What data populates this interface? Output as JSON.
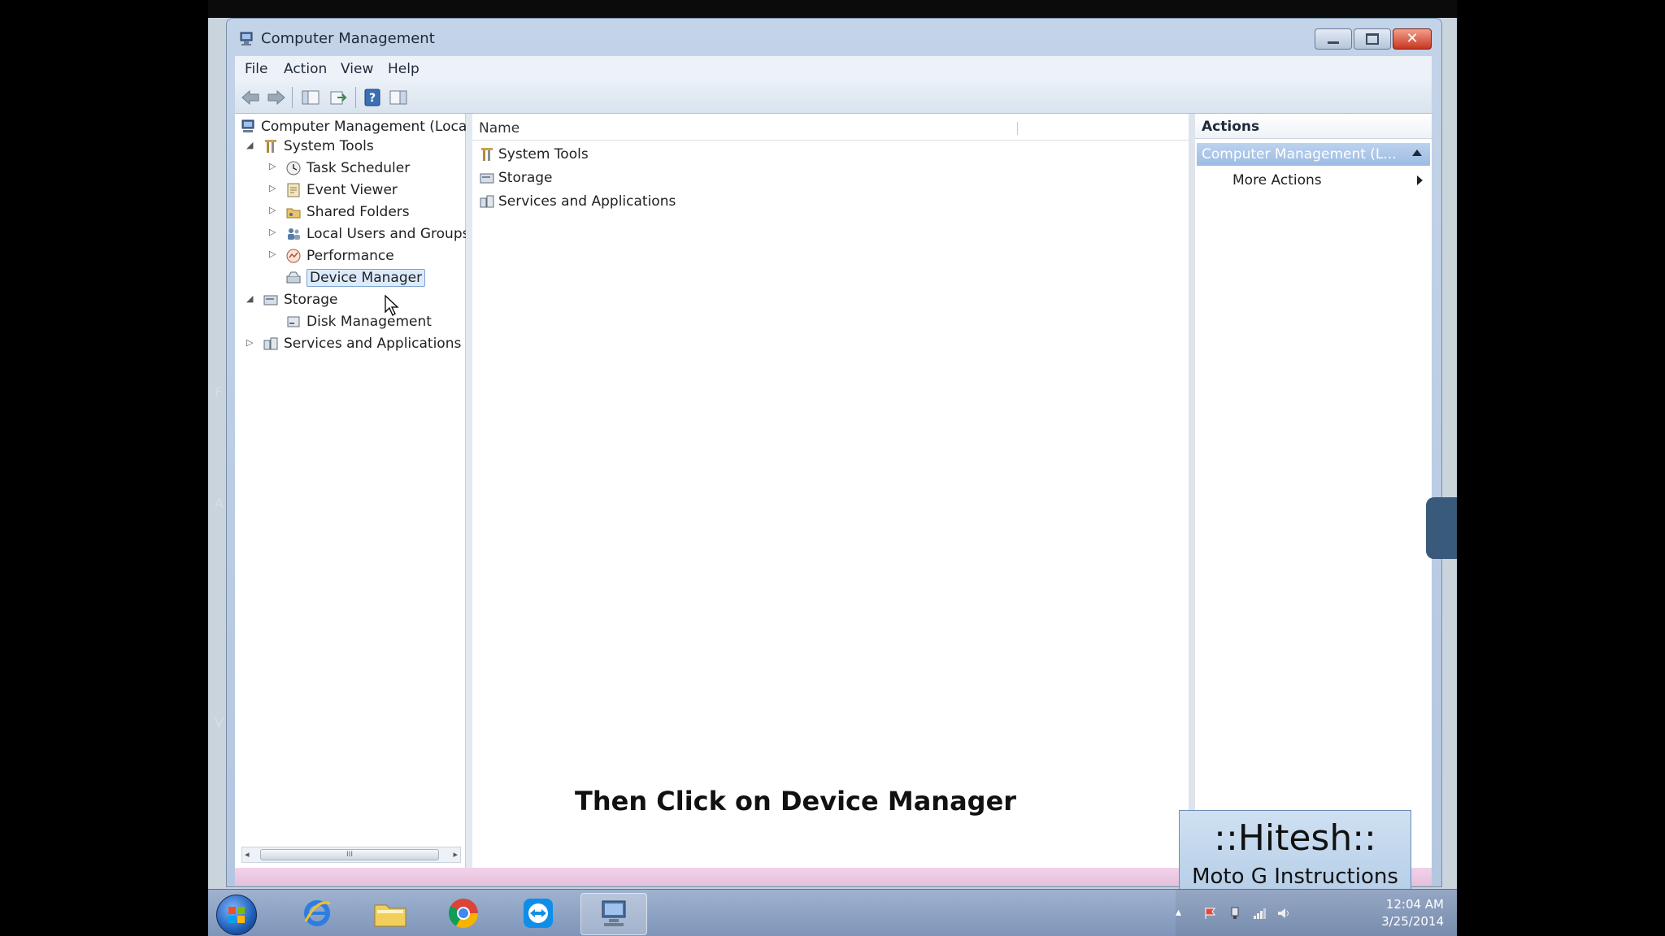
{
  "desktop": {
    "left_fragments": [
      "F",
      "A",
      "V"
    ]
  },
  "window": {
    "title": "Computer Management",
    "controls": {
      "minimize": "",
      "maximize": "",
      "close": "✕"
    }
  },
  "menu": [
    "File",
    "Action",
    "View",
    "Help"
  ],
  "toolbar": [
    "back-icon",
    "forward-icon",
    "show-hide-tree-icon",
    "export-list-icon",
    "help-icon",
    "show-hide-action-pane-icon"
  ],
  "tree": {
    "root": "Computer Management (Local",
    "items": [
      {
        "label": "System Tools",
        "level": 1,
        "expanded": true
      },
      {
        "label": "Task Scheduler",
        "level": 2
      },
      {
        "label": "Event Viewer",
        "level": 2
      },
      {
        "label": "Shared Folders",
        "level": 2
      },
      {
        "label": "Local Users and Groups",
        "level": 2
      },
      {
        "label": "Performance",
        "level": 2
      },
      {
        "label": "Device Manager",
        "level": 2,
        "selected": true
      },
      {
        "label": "Storage",
        "level": 1,
        "expanded": true
      },
      {
        "label": "Disk Management",
        "level": 2
      },
      {
        "label": "Services and Applications",
        "level": 1
      }
    ],
    "scrollbar_thumb": "III"
  },
  "list": {
    "column_name": "Name",
    "rows": [
      "System Tools",
      "Storage",
      "Services and Applications"
    ]
  },
  "actions": {
    "title": "Actions",
    "section": "Computer Management (L...",
    "more": "More Actions"
  },
  "caption": "Then Click on Device Manager",
  "overlay": {
    "line1": "::Hitesh::",
    "line2": "Moto G Instructions"
  },
  "taskbar": {
    "apps": [
      "internet-explorer-icon",
      "file-explorer-icon",
      "chrome-icon",
      "teamviewer-icon",
      "computer-management-icon"
    ],
    "clock": {
      "time": "12:04 AM",
      "date": "3/25/2014"
    }
  },
  "colors": {
    "selection": "#dcebfc",
    "actions_header": "#9cbbe3",
    "statusbar": "#e6c0dc",
    "taskbar": "#8fa4c4"
  }
}
